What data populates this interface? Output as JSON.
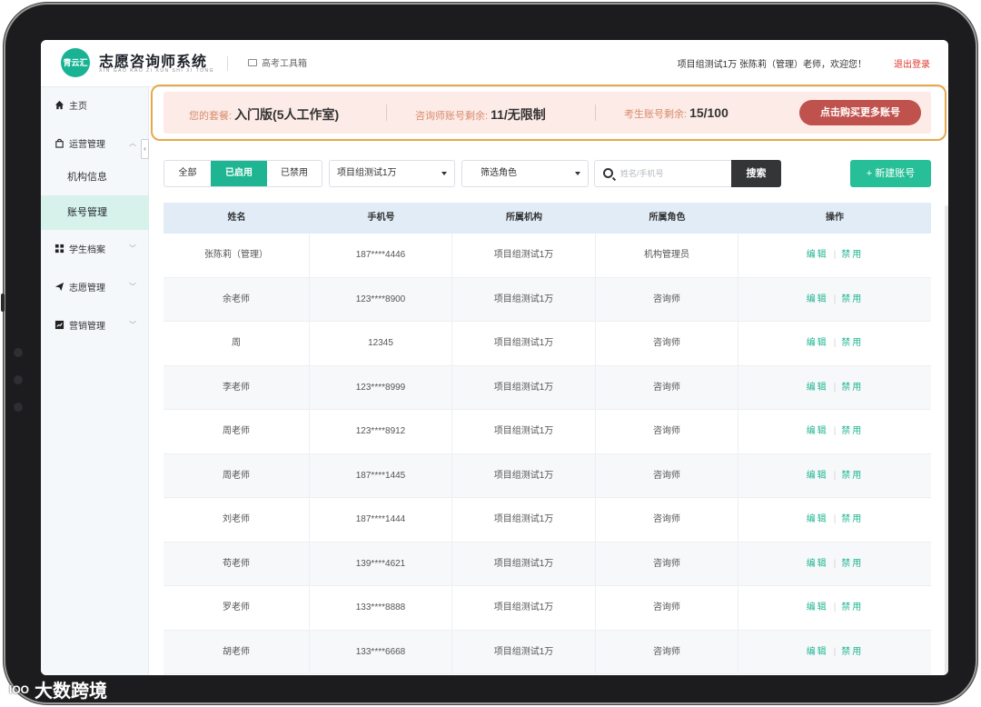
{
  "app": {
    "logo_badge": "青云汇",
    "title": "志愿咨询师系统",
    "subtitle": "XIN GAO KAO ZI XUN SHI XI TONG",
    "toolbox": "高考工具箱",
    "welcome": "项目组测试1万 张陈莉（管理）老师，欢迎您！",
    "logout": "退出登录"
  },
  "sidebar": {
    "collapse": "‹",
    "items": [
      {
        "label": "主页",
        "icon": "home-icon"
      },
      {
        "label": "运营管理",
        "icon": "bag-icon",
        "expanded": true
      },
      {
        "label": "机构信息"
      },
      {
        "label": "账号管理",
        "active": true
      },
      {
        "label": "学生档案",
        "icon": "grid-icon"
      },
      {
        "label": "志愿管理",
        "icon": "paper-plane-icon"
      },
      {
        "label": "营销管理",
        "icon": "chart-icon"
      }
    ]
  },
  "banner": {
    "plan_label": "您的套餐:",
    "plan_value": "入门版(5人工作室)",
    "consultant_label": "咨询师账号剩余:",
    "consultant_value": "11/无限制",
    "student_label": "考生账号剩余:",
    "student_value": "15/100",
    "buy_label": "点击购买更多账号"
  },
  "filters": {
    "status_tabs": [
      "全部",
      "已启用",
      "已禁用"
    ],
    "status_selected": "已启用",
    "org_select": "项目组测试1万",
    "role_select": "筛选角色",
    "search_placeholder": "姓名/手机号",
    "search_button": "搜索",
    "new_button": "+ 新建账号"
  },
  "table": {
    "columns": [
      "姓名",
      "手机号",
      "所属机构",
      "所属角色",
      "操作"
    ],
    "actions": {
      "edit": "编辑",
      "disable": "禁用",
      "separator": "|"
    },
    "rows": [
      [
        "张陈莉（管理）",
        "187****4446",
        "项目组测试1万",
        "机构管理员"
      ],
      [
        "余老师",
        "123****8900",
        "项目组测试1万",
        "咨询师"
      ],
      [
        "周",
        "12345",
        "项目组测试1万",
        "咨询师"
      ],
      [
        "李老师",
        "123****8999",
        "项目组测试1万",
        "咨询师"
      ],
      [
        "周老师",
        "123****8912",
        "项目组测试1万",
        "咨询师"
      ],
      [
        "周老师",
        "187****1445",
        "项目组测试1万",
        "咨询师"
      ],
      [
        "刘老师",
        "187****1444",
        "项目组测试1万",
        "咨询师"
      ],
      [
        "苟老师",
        "139****4621",
        "项目组测试1万",
        "咨询师"
      ],
      [
        "罗老师",
        "133****8888",
        "项目组测试1万",
        "咨询师"
      ],
      [
        "胡老师",
        "133****6668",
        "项目组测试1万",
        "咨询师"
      ]
    ]
  },
  "watermark": {
    "logo": "lOO",
    "text": "大数跨境"
  },
  "colors": {
    "accent": "#1fb592",
    "buy": "#c0524e",
    "banner_bg": "#fcebe6",
    "highlight": "#e7a84b"
  }
}
